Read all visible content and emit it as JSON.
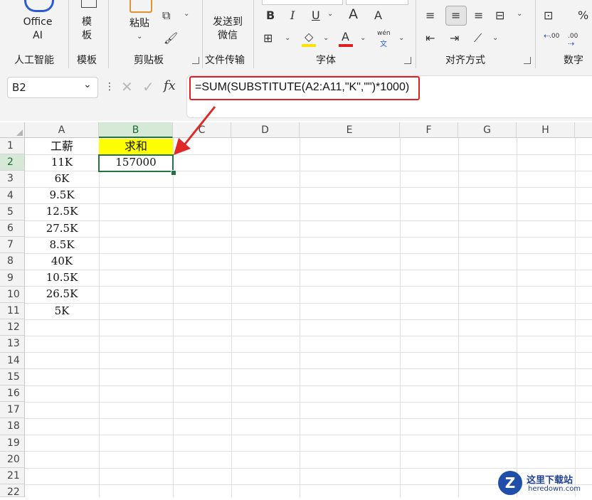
{
  "ribbon": {
    "office_ai_label": "Office AI",
    "template_label": "模板",
    "paste_label": "粘贴",
    "send_label": "发送到微信",
    "groups": {
      "ai": "人工智能",
      "template": "模板",
      "clipboard": "剪贴板",
      "file_transfer": "文件传输",
      "font": "字体",
      "alignment": "对齐方式",
      "number": "数字"
    },
    "font_tools": {
      "bold": "B",
      "italic": "I",
      "underline": "U",
      "grow": "A",
      "shrink": "A",
      "font_color": "A",
      "phonetic_top": "wén",
      "phonetic_bottom": "文"
    },
    "number_tools": {
      "percent": "%",
      "inc_decimal": ".00",
      "dec_decimal": ".00"
    },
    "colors": {
      "highlight": "#ffe000",
      "font_red": "#e02020"
    }
  },
  "formula_bar": {
    "name_box": "B2",
    "fx": "fx",
    "formula": "=SUM(SUBSTITUTE(A2:A11,\"K\",\"\")*1000)"
  },
  "sheet": {
    "columns": [
      "A",
      "B",
      "C",
      "D",
      "E",
      "F",
      "G",
      "H"
    ],
    "rows": [
      "1",
      "2",
      "3",
      "4",
      "5",
      "6",
      "7",
      "8",
      "9",
      "10",
      "11",
      "12",
      "13",
      "14",
      "15",
      "16",
      "17",
      "18",
      "19",
      "20",
      "21",
      "22"
    ],
    "col_a": [
      "工薪",
      "11K",
      "6K",
      "9.5K",
      "12.5K",
      "27.5K",
      "8.5K",
      "40K",
      "10.5K",
      "26.5K",
      "5K"
    ],
    "b1": "求和",
    "b2": "157000",
    "selected_column": "B",
    "selected_row": "2",
    "header_fill": "#ffff00",
    "selection_color": "#217346"
  },
  "watermark": {
    "name": "这里下载站",
    "url": "heredown.com"
  }
}
